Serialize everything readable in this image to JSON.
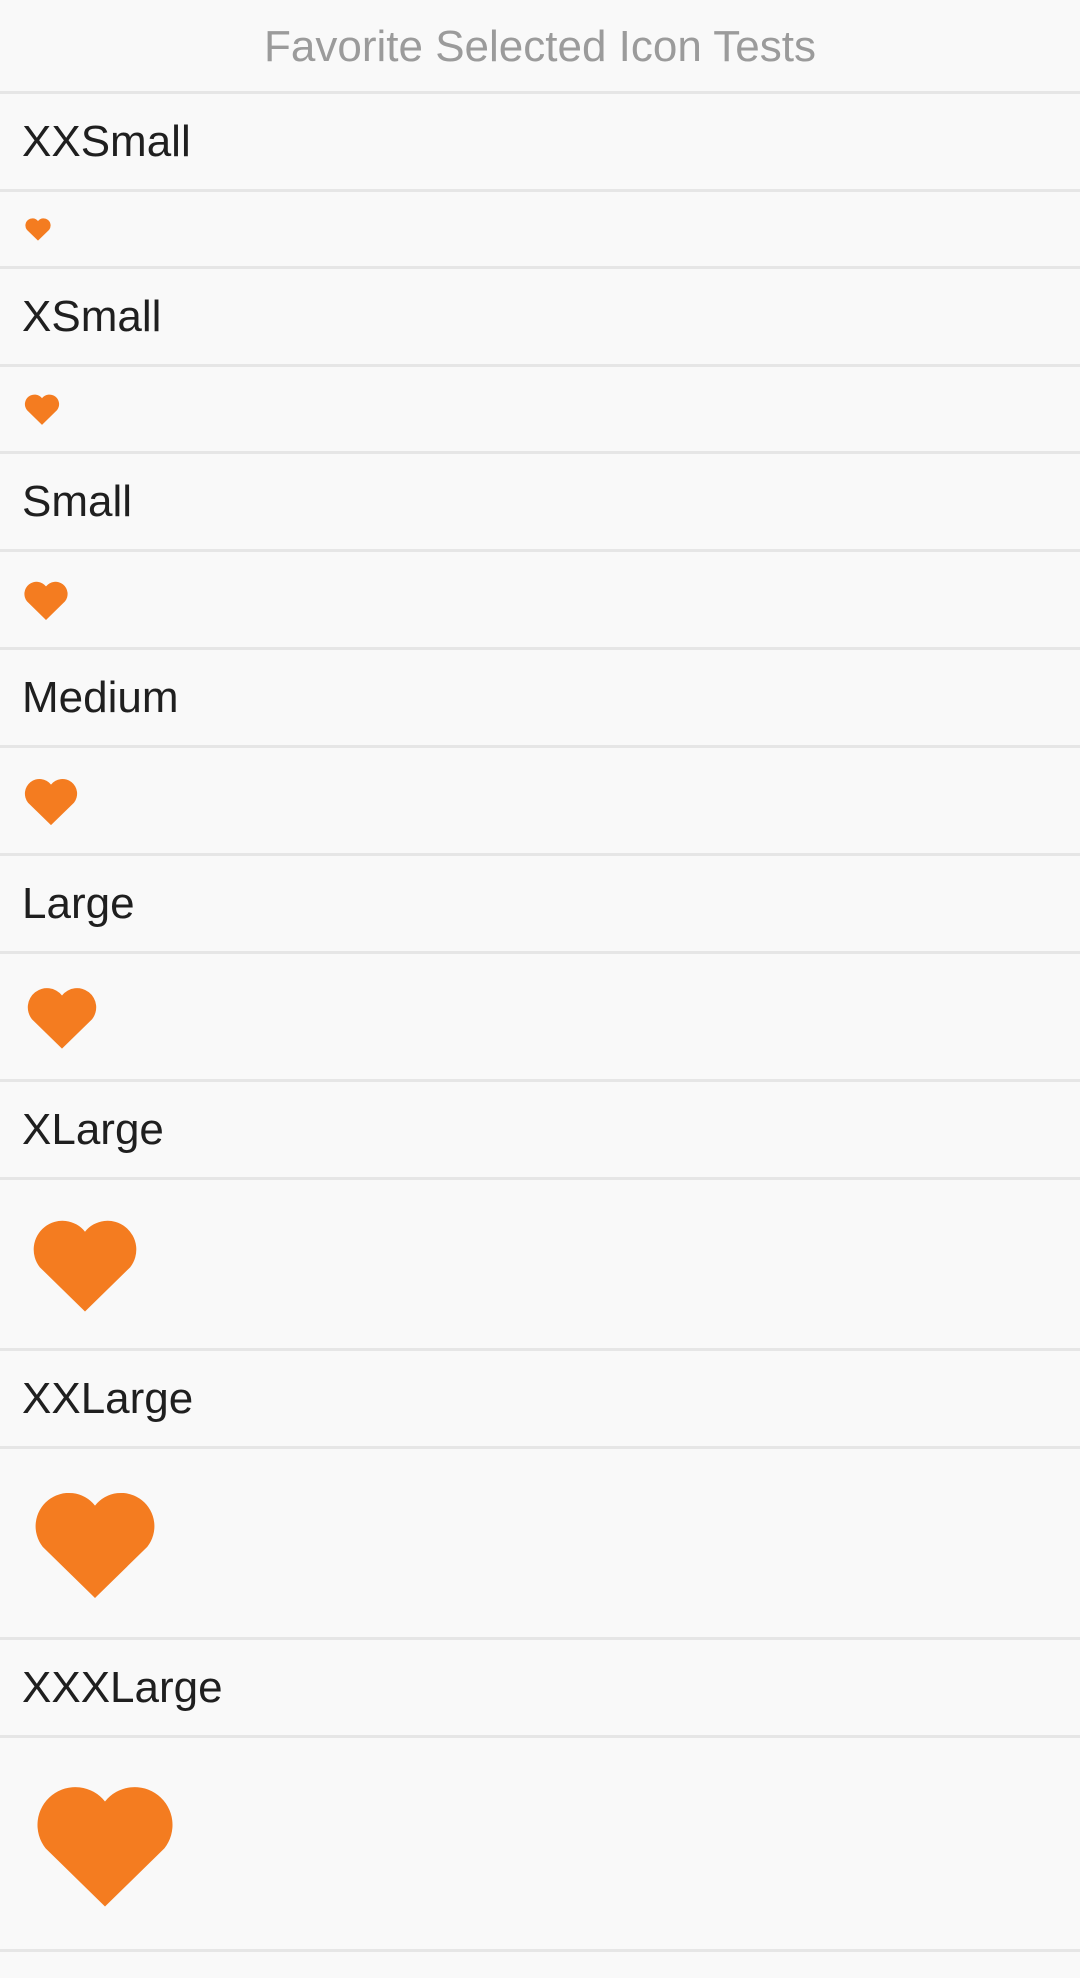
{
  "header": {
    "title": "Favorite Selected Icon Tests"
  },
  "accent_color": "#f47c20",
  "sections": [
    {
      "label": "XXSmall",
      "icon": "heart-icon"
    },
    {
      "label": "XSmall",
      "icon": "heart-icon"
    },
    {
      "label": "Small",
      "icon": "heart-icon"
    },
    {
      "label": "Medium",
      "icon": "heart-icon"
    },
    {
      "label": "Large",
      "icon": "heart-icon"
    },
    {
      "label": "XLarge",
      "icon": "heart-icon"
    },
    {
      "label": "XXLarge",
      "icon": "heart-icon"
    },
    {
      "label": "XXXLarge",
      "icon": "heart-icon"
    }
  ]
}
